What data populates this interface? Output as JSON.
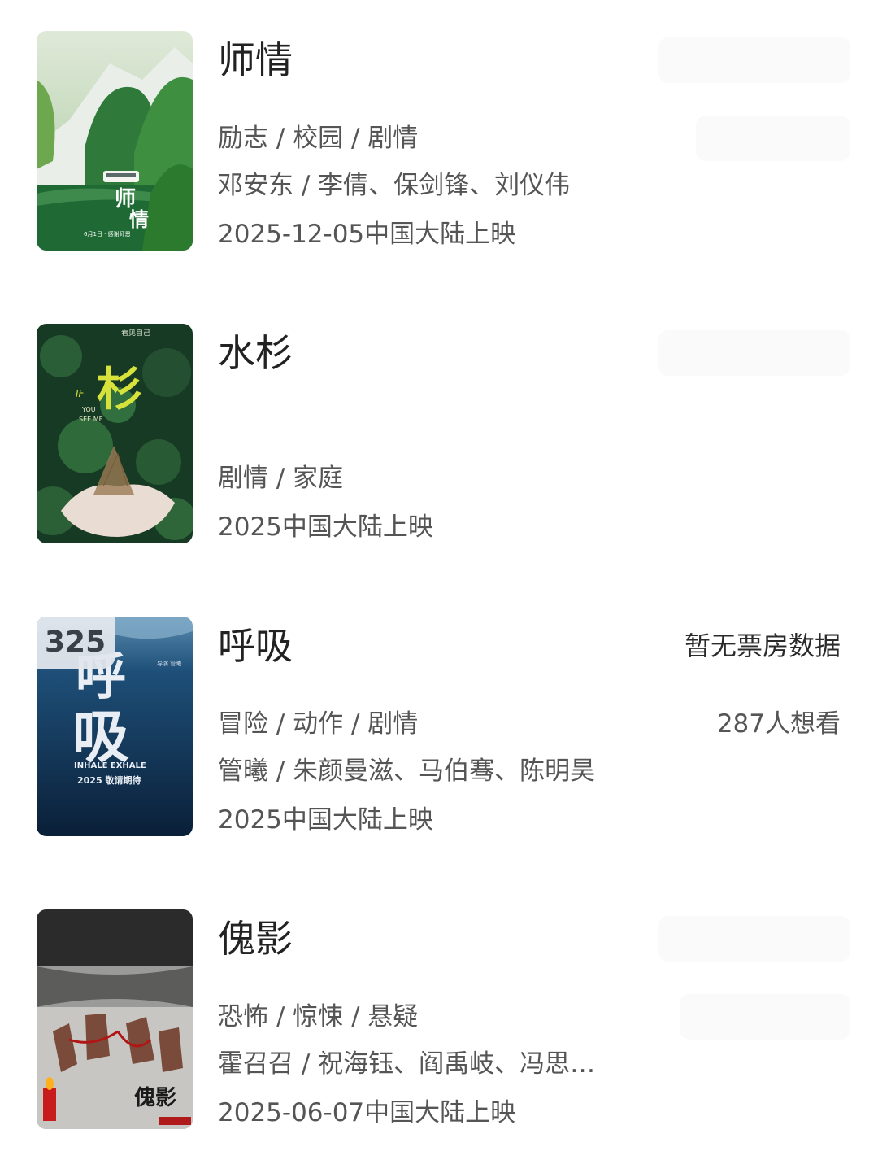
{
  "movies": [
    {
      "title": "师情",
      "genres": "励志 / 校园 / 剧情",
      "credits": "邓安东 / 李倩、保剑锋、刘仪伟",
      "release": "2025-12-05中国大陆上映",
      "poster": {
        "theme": "green-mountain",
        "accent": "#3c8a3a",
        "text": "师情",
        "caption": "6月1日 · 感谢师恩"
      }
    },
    {
      "title": "水杉",
      "genres": "剧情 / 家庭",
      "credits": "",
      "release": "2025中国大陆上映",
      "poster": {
        "theme": "dark-leaves",
        "accent": "#1e4a2c",
        "text": "杉",
        "subtitle_en": "IF YOU SEE ME",
        "top_text": "看见自己"
      }
    },
    {
      "title": "呼吸",
      "genres": "冒险 / 动作 / 剧情",
      "credits": "管曦 / 朱颜曼滋、马伯骞、陈明昊",
      "release": "2025中国大陆上映",
      "rank_badge": "325",
      "box_office": "暂无票房数据",
      "want_to_see": "287人想看",
      "poster": {
        "theme": "deep-blue-water",
        "accent": "#0e2f52",
        "text": "呼吸",
        "subtitle_en": "INHALE EXHALE",
        "tagline": "2025 敬请期待"
      }
    },
    {
      "title": "傀影",
      "genres": "恐怖 / 惊悚 / 悬疑",
      "credits": "霍召召 / 祝海钰、阎禹岐、冯思…",
      "release": "2025-06-07中国大陆上映",
      "poster": {
        "theme": "grey-horror",
        "accent": "#b01a1a",
        "text": "傀影"
      }
    }
  ]
}
